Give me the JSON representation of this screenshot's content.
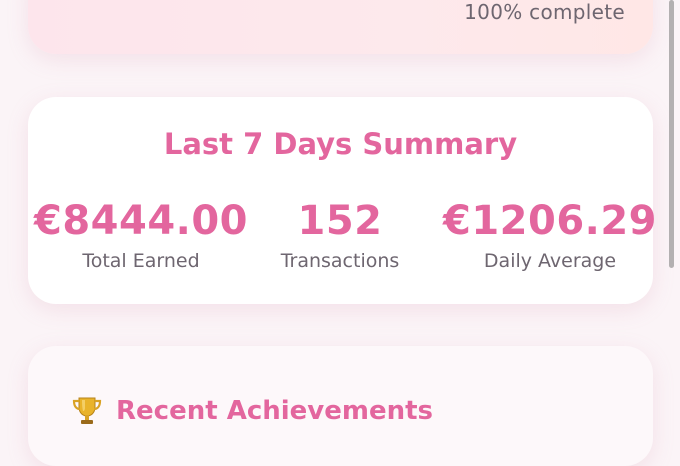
{
  "progress": {
    "caption": "100% complete"
  },
  "summary": {
    "title": "Last 7 Days Summary",
    "stats": [
      {
        "value": "€8444.00",
        "label": "Total Earned"
      },
      {
        "value": "152",
        "label": "Transactions"
      },
      {
        "value": "€1206.29",
        "label": "Daily Average"
      }
    ]
  },
  "achievements": {
    "icon": "trophy-icon",
    "title": "Recent Achievements"
  },
  "colors": {
    "accent": "#e3669e",
    "muted_text": "#6e6670",
    "background": "#fbf4f7"
  }
}
